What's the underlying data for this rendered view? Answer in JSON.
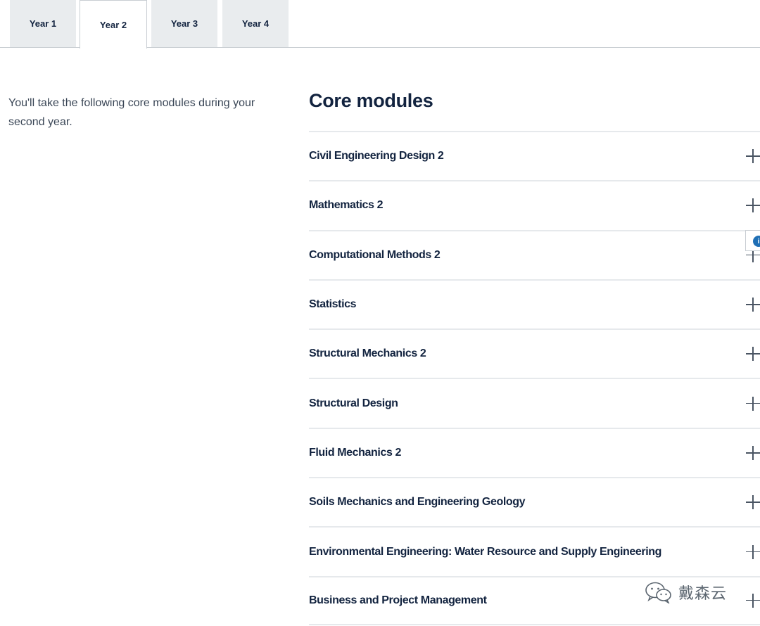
{
  "tabs": [
    {
      "label": "Year 1",
      "active": false
    },
    {
      "label": "Year 2",
      "active": true
    },
    {
      "label": "Year 3",
      "active": false
    },
    {
      "label": "Year 4",
      "active": false
    }
  ],
  "intro": {
    "text": "You'll take the following core modules during your second year."
  },
  "core_modules": {
    "heading": "Core modules",
    "items": [
      {
        "label": "Civil Engineering Design 2",
        "icon": "plus-icon"
      },
      {
        "label": "Mathematics 2",
        "icon": "plus-icon"
      },
      {
        "label": "Computational Methods 2",
        "icon": "plus-icon"
      },
      {
        "label": "Statistics",
        "icon": "plus-icon"
      },
      {
        "label": "Structural Mechanics 2",
        "icon": "plus-icon"
      },
      {
        "label": "Structural Design",
        "icon": "plus-icon"
      },
      {
        "label": "Fluid Mechanics 2",
        "icon": "plus-icon"
      },
      {
        "label": "Soils Mechanics and Engineering Geology",
        "icon": "plus-icon"
      },
      {
        "label": "Environmental Engineering: Water Resource and Supply Engineering",
        "icon": "plus-icon"
      },
      {
        "label": "Business and Project Management",
        "icon": "plus-icon"
      }
    ]
  },
  "feedback_widget": {
    "glyph": "i",
    "icon": "info-icon",
    "color": "#1f6fb5"
  },
  "watermark": {
    "text": "戴森云",
    "icon": "wechat-icon"
  },
  "colors": {
    "text_primary": "#12233f",
    "tab_bg": "#e9ecee",
    "divider": "#e6e9ec"
  }
}
